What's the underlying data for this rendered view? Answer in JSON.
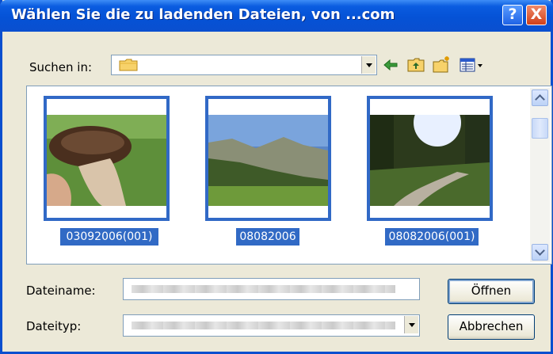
{
  "window": {
    "title": "Wählen Sie die zu ladenden Dateien, von ...com",
    "help_glyph": "?",
    "close_glyph": "X"
  },
  "toolbar": {
    "look_in_label": "Suchen in:",
    "look_in_value": "",
    "icons": [
      "back-arrow-icon",
      "up-folder-icon",
      "new-folder-icon",
      "view-menu-icon"
    ]
  },
  "files": [
    {
      "name": "03092006(001)"
    },
    {
      "name": "08082006"
    },
    {
      "name": "08082006(001)"
    }
  ],
  "form": {
    "filename_label": "Dateiname:",
    "filetype_label": "Dateityp:",
    "open_label": "Öffnen",
    "cancel_label": "Abbrechen"
  },
  "colors": {
    "titlebar": "#0a4fcf",
    "selection": "#316ac5",
    "dialog_bg": "#ece9d8"
  }
}
